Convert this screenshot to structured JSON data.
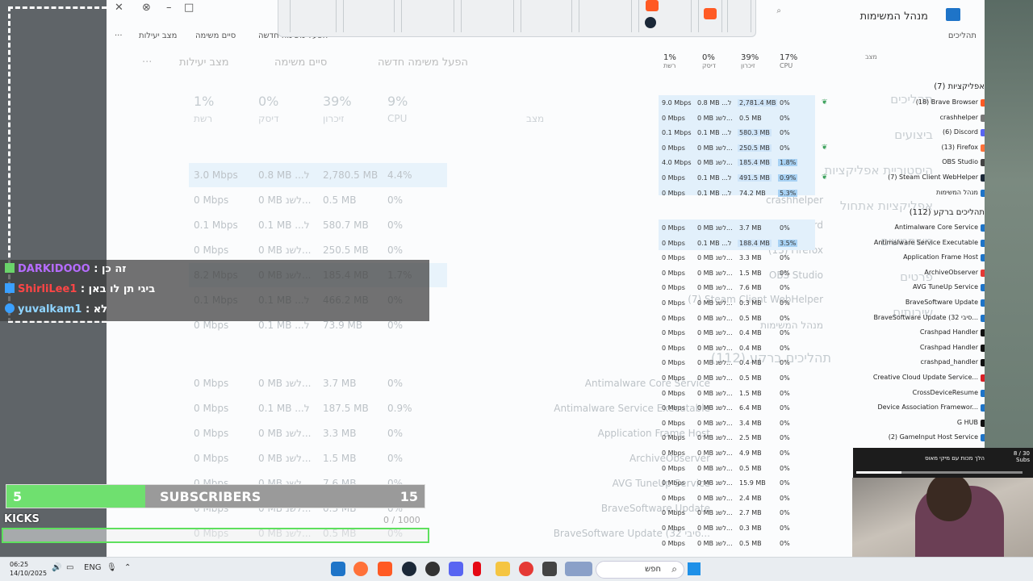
{
  "window": {
    "title": "מנהל המשימות",
    "close": "✕",
    "minimize": "–",
    "maximize": "□"
  },
  "toolbar_small": {
    "new_task": "הפעל משימה חדשה",
    "end_task": "סיים משימה",
    "efficiency": "מצב יעילות",
    "more": "···"
  },
  "ghost": {
    "new_task": "הפעל משימה חדשה",
    "end_task": "סיים משימה",
    "efficiency": "מצב יעילות",
    "nav": [
      "תהליכים",
      "ביצועים",
      "היסטוריית אפליקציות",
      "אפליקציות אתחול",
      "משתמשים",
      "פרטים",
      "שירותים"
    ],
    "processes_title": "תהליכים",
    "bg_title": "תהליכים ברקע (112)",
    "headers": [
      {
        "pct": "1%",
        "label": "רשת"
      },
      {
        "pct": "0%",
        "label": "דיסק"
      },
      {
        "pct": "39%",
        "label": "זיכרון"
      },
      {
        "pct": "9%",
        "label": "CPU"
      },
      {
        "pct": "",
        "label": "מצב"
      }
    ],
    "names": [
      "(18) Brave Browser",
      "crashhelper",
      "(6) Discord",
      "(13) Firefox",
      "OBS Studio",
      "(7) Steam Client WebHelper",
      "מנהל המשימות"
    ],
    "bg_names": [
      "Antimalware Core Service",
      "Antimalware Service Executable",
      "Application Frame Host",
      "ArchiveObserver",
      "AVG TuneUp Service",
      "BraveSoftware Update",
      "BraveSoftware Update (32 סיבי..."
    ],
    "rows": [
      [
        "3.0 Mbps",
        "0.8 MB ...ל",
        "2,780.5 MB",
        "4.4%"
      ],
      [
        "0 Mbps",
        "0 MB לשנ...",
        "0.5 MB",
        "0%"
      ],
      [
        "0.1 Mbps",
        "0.1 MB ...ל",
        "580.7 MB",
        "0%"
      ],
      [
        "0 Mbps",
        "0 MB לשנ...",
        "250.5 MB",
        "0%"
      ],
      [
        "8.2 Mbps",
        "0 MB לשנ...",
        "185.4 MB",
        "1.7%"
      ],
      [
        "0.1 Mbps",
        "0.1 MB ...ל",
        "466.2 MB",
        "0%"
      ],
      [
        "0 Mbps",
        "0.1 MB ...ל",
        "73.9 MB",
        "0%"
      ],
      [
        "0 Mbps",
        "0 MB לשנ...",
        "3.7 MB",
        "0%"
      ],
      [
        "0 Mbps",
        "0.1 MB ...ל",
        "187.5 MB",
        "0.9%"
      ],
      [
        "0 Mbps",
        "0 MB לשנ...",
        "3.3 MB",
        "0%"
      ],
      [
        "0 Mbps",
        "0 MB לשנ...",
        "1.5 MB",
        "0%"
      ],
      [
        "0 Mbps",
        "0 MB לשנ...",
        "7.6 MB",
        "0%"
      ],
      [
        "0 Mbps",
        "0 MB לשנ...",
        "0.3 MB",
        "0%"
      ],
      [
        "0 Mbps",
        "0 MB לשנ...",
        "0.5 MB",
        "0%"
      ]
    ]
  },
  "table": {
    "headers": [
      {
        "pct": "1%",
        "label": "רשת"
      },
      {
        "pct": "0%",
        "label": "דיסק"
      },
      {
        "pct": "39%",
        "label": "זיכרון"
      },
      {
        "pct": "17%",
        "label": "CPU"
      },
      {
        "pct": "",
        "label": "מצב"
      }
    ],
    "apps_title": "אפליקציות (7)",
    "bg_title": "תהליכים ברקע (112)",
    "nav_title": "תהליכים",
    "rows": [
      {
        "net": "9.0 Mbps",
        "disk": "0.8 MB ...ל",
        "mem": "2,781.4 MB",
        "cpu": "0%",
        "name": "(18) Brave Browser",
        "color": "#ff5a24",
        "leaf": true
      },
      {
        "net": "0 Mbps",
        "disk": "0 MB לשנ...",
        "mem": "0.5 MB",
        "cpu": "0%",
        "name": "crashhelper",
        "color": "#777777",
        "leaf": false
      },
      {
        "net": "0.1 Mbps",
        "disk": "0.1 MB ...ל",
        "mem": "580.3 MB",
        "cpu": "0%",
        "name": "(6) Discord",
        "color": "#5865f2",
        "leaf": false
      },
      {
        "net": "0 Mbps",
        "disk": "0 MB לשנ...",
        "mem": "250.5 MB",
        "cpu": "0%",
        "name": "(13) Firefox",
        "color": "#ff7139",
        "leaf": true
      },
      {
        "net": "4.0 Mbps",
        "disk": "0 MB לשנ...",
        "mem": "185.4 MB",
        "cpu": "1.8%",
        "name": "OBS Studio",
        "color": "#444444",
        "leaf": false
      },
      {
        "net": "0 Mbps",
        "disk": "0.1 MB ...ל",
        "mem": "491.5 MB",
        "cpu": "0.9%",
        "name": "(7) Steam Client WebHelper",
        "color": "#1b2838",
        "leaf": true
      },
      {
        "net": "0 Mbps",
        "disk": "0.1 MB ...ל",
        "mem": "74.2 MB",
        "cpu": "5.3%",
        "name": "מנהל המשימות",
        "color": "#1e74c8",
        "leaf": false
      },
      {
        "net": "0 Mbps",
        "disk": "0 MB לשנ...",
        "mem": "3.7 MB",
        "cpu": "0%",
        "name": "Antimalware Core Service",
        "color": "#1e74c8",
        "leaf": false
      },
      {
        "net": "0 Mbps",
        "disk": "0.1 MB ...ל",
        "mem": "188.4 MB",
        "cpu": "3.5%",
        "name": "Antimalware Service Executable",
        "color": "#1e74c8",
        "leaf": false
      },
      {
        "net": "0 Mbps",
        "disk": "0 MB לשנ...",
        "mem": "3.3 MB",
        "cpu": "0%",
        "name": "Application Frame Host",
        "color": "#1e74c8",
        "leaf": false
      },
      {
        "net": "0 Mbps",
        "disk": "0 MB לשנ...",
        "mem": "1.5 MB",
        "cpu": "0%",
        "name": "ArchiveObserver",
        "color": "#e53935",
        "leaf": false
      },
      {
        "net": "0 Mbps",
        "disk": "0 MB לשנ...",
        "mem": "7.6 MB",
        "cpu": "0%",
        "name": "AVG TuneUp Service",
        "color": "#1e74c8",
        "leaf": false
      },
      {
        "net": "0 Mbps",
        "disk": "0 MB לשנ...",
        "mem": "0.3 MB",
        "cpu": "0%",
        "name": "BraveSoftware Update",
        "color": "#1e74c8",
        "leaf": false
      },
      {
        "net": "0 Mbps",
        "disk": "0 MB לשנ...",
        "mem": "0.5 MB",
        "cpu": "0%",
        "name": "BraveSoftware Update (32 סיבי...",
        "color": "#1e74c8",
        "leaf": false
      },
      {
        "net": "0 Mbps",
        "disk": "0 MB לשנ...",
        "mem": "0.4 MB",
        "cpu": "0%",
        "name": "Crashpad Handler",
        "color": "#111111",
        "leaf": false
      },
      {
        "net": "0 Mbps",
        "disk": "0 MB לשנ...",
        "mem": "0.4 MB",
        "cpu": "0%",
        "name": "Crashpad Handler",
        "color": "#111111",
        "leaf": false
      },
      {
        "net": "0 Mbps",
        "disk": "0 MB לשנ...",
        "mem": "0.4 MB",
        "cpu": "0%",
        "name": "crashpad_handler",
        "color": "#111111",
        "leaf": false
      },
      {
        "net": "0 Mbps",
        "disk": "0 MB לשנ...",
        "mem": "0.5 MB",
        "cpu": "0%",
        "name": "Creative Cloud Update Service...",
        "color": "#da1f26",
        "leaf": false
      },
      {
        "net": "0 Mbps",
        "disk": "0 MB לשנ...",
        "mem": "1.5 MB",
        "cpu": "0%",
        "name": "CrossDeviceResume",
        "color": "#1e74c8",
        "leaf": false
      },
      {
        "net": "0 Mbps",
        "disk": "0 MB לשנ...",
        "mem": "6.4 MB",
        "cpu": "0%",
        "name": "Device Association Framewor...",
        "color": "#1e74c8",
        "leaf": false
      },
      {
        "net": "0 Mbps",
        "disk": "0 MB לשנ...",
        "mem": "3.4 MB",
        "cpu": "0%",
        "name": "G HUB",
        "color": "#111111",
        "leaf": false
      },
      {
        "net": "0 Mbps",
        "disk": "0 MB לשנ...",
        "mem": "2.5 MB",
        "cpu": "0%",
        "name": "(2) GameInput Host Service",
        "color": "#1e74c8",
        "leaf": false
      },
      {
        "net": "0 Mbps",
        "disk": "0 MB לשנ...",
        "mem": "4.9 MB",
        "cpu": "0%",
        "name": "",
        "color": "#1e74c8",
        "leaf": false
      },
      {
        "net": "0 Mbps",
        "disk": "0 MB לשנ...",
        "mem": "0.5 MB",
        "cpu": "0%",
        "name": "",
        "color": "#1e74c8",
        "leaf": false
      },
      {
        "net": "0 Mbps",
        "disk": "0 MB לשנ...",
        "mem": "15.9 MB",
        "cpu": "0%",
        "name": "",
        "color": "#1e74c8",
        "leaf": false
      },
      {
        "net": "0 Mbps",
        "disk": "0 MB לשנ...",
        "mem": "2.4 MB",
        "cpu": "0%",
        "name": "",
        "color": "#1e74c8",
        "leaf": false
      },
      {
        "net": "0 Mbps",
        "disk": "0 MB לשנ...",
        "mem": "2.7 MB",
        "cpu": "0%",
        "name": "",
        "color": "#1e74c8",
        "leaf": false
      },
      {
        "net": "0 Mbps",
        "disk": "0 MB לשנ...",
        "mem": "0.3 MB",
        "cpu": "0%",
        "name": "",
        "color": "#1e74c8",
        "leaf": false
      },
      {
        "net": "0 Mbps",
        "disk": "0 MB לשנ...",
        "mem": "0.5 MB",
        "cpu": "0%",
        "name": "",
        "color": "#1e74c8",
        "leaf": false
      }
    ]
  },
  "chat": [
    {
      "user": "DARKIDOOO",
      "msg": ": זה כן",
      "color": "#b66cff"
    },
    {
      "user": "ShirliLee1",
      "msg": ": ביגי תן לו באן",
      "color": "#ff4545"
    },
    {
      "user": "yuvalkam1",
      "msg": ": לא",
      "color": "#8fd4ff"
    }
  ],
  "subs": {
    "current": "5",
    "label": "SUBSCRIBERS",
    "goal": "15",
    "progress": 0.333
  },
  "kicks": {
    "label": "KICKS",
    "goal_text": "0 / 1000"
  },
  "goal_widget": {
    "title": "הלך מכות עם מיקי מאוס",
    "count": "8 / 30",
    "unit": "Subs",
    "progress": 0.27
  },
  "taskbar": {
    "time": "06:25",
    "date": "14/10/2025",
    "lang": "ENG",
    "search": "חפש"
  }
}
